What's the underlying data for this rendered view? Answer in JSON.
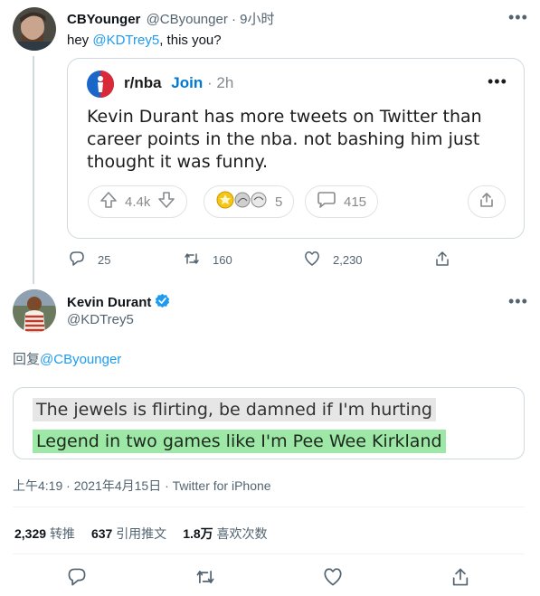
{
  "tweet1": {
    "name": "CBYounger",
    "handle": "@CByounger",
    "time": "· 9小时",
    "text_prefix": "hey ",
    "mention": "@KDTrey5",
    "text_suffix": ", this you?",
    "replies": "25",
    "retweets": "160",
    "likes": "2,230"
  },
  "reddit": {
    "subreddit": "r/nba",
    "join": "Join",
    "time": "· 2h",
    "title": "Kevin Durant has more tweets on Twitter than career points in the nba. not bashing him just thought it was funny.",
    "upvotes": "4.4k",
    "award_count": "5",
    "comments": "415"
  },
  "tweet2": {
    "name": "Kevin Durant",
    "handle": "@KDTrey5",
    "reply_label": "回复",
    "reply_to": "@CByounger",
    "lyric1": "The jewels is flirting, be damned if I'm hurting",
    "lyric2": "Legend in two games like I'm Pee Wee Kirkland",
    "meta": "上午4:19 · 2021年4月15日 · Twitter for iPhone",
    "stats": {
      "retweets": "2,329",
      "retweets_label": "转推",
      "quotes": "637",
      "quotes_label": "引用推文",
      "likes": "1.8万",
      "likes_label": "喜欢次数"
    }
  },
  "colors": {
    "accent": "#1d9bf0",
    "verified": "#1d9bf0",
    "highlight_gray": "#e6e6e6",
    "highlight_green": "#9de8a6",
    "reddit_icon": "#1a66c9"
  },
  "icons": [
    "more-icon",
    "reddit-nba-icon",
    "upvote-icon",
    "downvote-icon",
    "award-icon",
    "comment-icon",
    "share-icon",
    "reply-icon",
    "retweet-icon",
    "like-icon",
    "verified-badge-icon"
  ]
}
